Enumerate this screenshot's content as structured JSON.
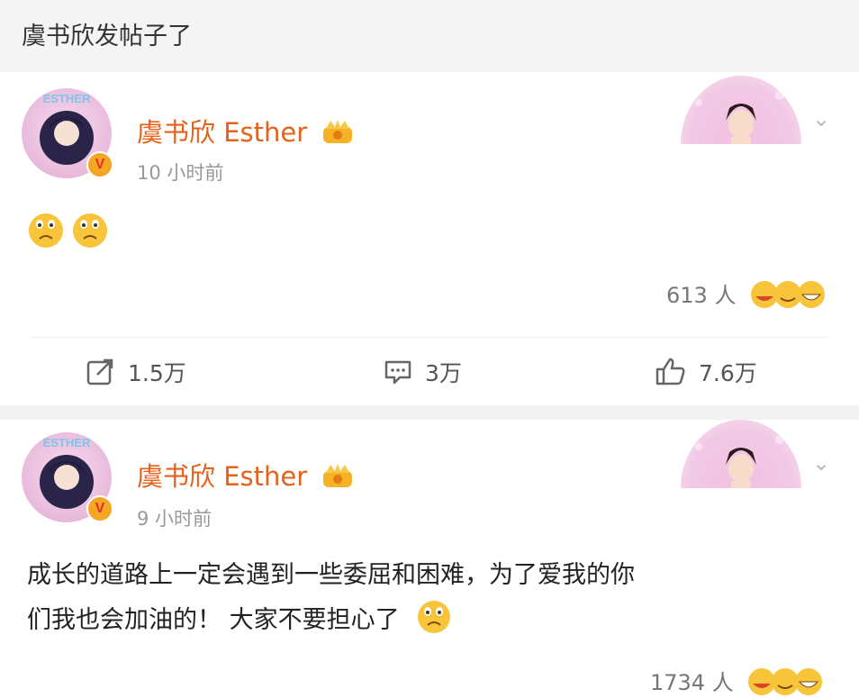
{
  "headline": "虞书欣发帖子了",
  "posts": [
    {
      "username": "虞书欣 Esther",
      "time": "10 小时前",
      "text": "",
      "content_emojis": [
        "sad-face-icon",
        "sad-face-icon"
      ],
      "likers_count": "613 人",
      "actions": {
        "repost": "1.5万",
        "comment": "3万",
        "like": "7.6万"
      }
    },
    {
      "username": "虞书欣 Esther",
      "time": "9 小时前",
      "text_line1": "成长的道路上一定会遇到一些委屈和困难，为了爱我的你",
      "text_line2": "们我也会加油的！ 大家不要担心了",
      "likers_count": "1734 人"
    }
  ],
  "colors": {
    "username": "#e8611a",
    "time": "#999999",
    "separator": "#f2f2f2",
    "verify_badge": "#f5a623"
  }
}
